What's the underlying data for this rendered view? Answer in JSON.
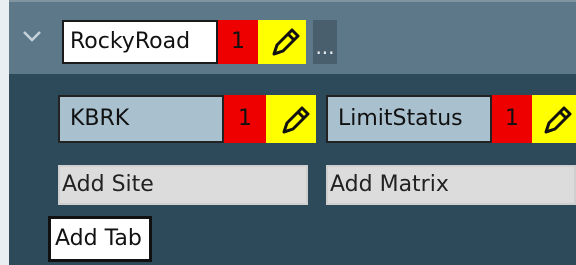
{
  "tab": {
    "name": "RockyRoad",
    "count": "1",
    "edit_icon": "pencil-icon",
    "collapse_icon": "chevron-down-icon",
    "more_label": "..."
  },
  "items": [
    {
      "label": "KBRK",
      "count": "1",
      "edit_icon": "pencil-icon"
    },
    {
      "label": "LimitStatus",
      "count": "1",
      "edit_icon": "pencil-icon"
    }
  ],
  "add_site": {
    "label": "Add Site"
  },
  "add_matrix": {
    "label": "Add Matrix"
  },
  "add_tab": {
    "label": "Add Tab"
  },
  "colors": {
    "background": "#2c4a5a",
    "header": "#5d7889",
    "badge_red": "#ee0000",
    "edit_yellow": "#ffff00",
    "item_blue": "#a9c0ce"
  }
}
